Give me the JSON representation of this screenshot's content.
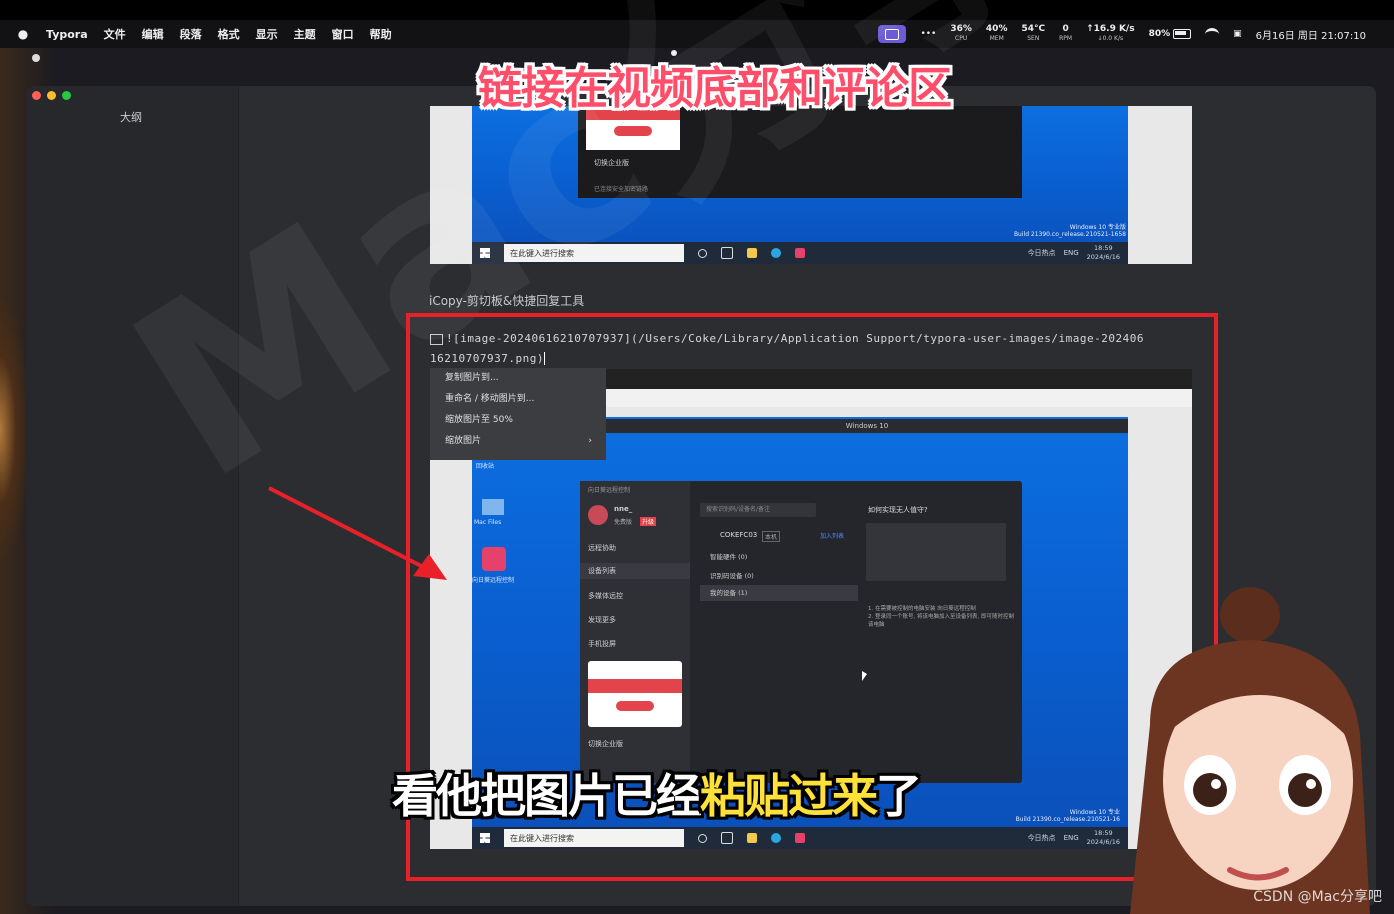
{
  "menubar": {
    "app_name": "Typora",
    "items": [
      "文件",
      "编辑",
      "段落",
      "格式",
      "显示",
      "主题",
      "窗口",
      "帮助"
    ],
    "stats": [
      {
        "value": "36%",
        "label": "CPU"
      },
      {
        "value": "40%",
        "label": "MEM"
      },
      {
        "value": "54°C",
        "label": "SEN"
      },
      {
        "value": "0",
        "label": "RPM"
      },
      {
        "value": "↑16.9 K/s",
        "label": "↓0.0 K/s"
      }
    ],
    "more": "•••",
    "battery": "80%",
    "datetime": "6月16日 周日 21:07:10"
  },
  "overlay": {
    "title": "链接在视频底部和评论区",
    "subtitle_plain": "看他把图片已经",
    "subtitle_highlight": "粘贴过来",
    "subtitle_end": "了",
    "csdn": "CSDN @Mac分享吧",
    "watermark": "Mac分享吧"
  },
  "sidebar": {
    "outline_title": "大纲"
  },
  "document": {
    "caption": "iCopy-剪切板&快捷回复工具",
    "md_line1": "![image-20240616210707937](/Users/Coke/Library/Application Support/typora-user-images/image-202406",
    "md_line2": "16210707937.png)",
    "context_menu": [
      "复制图片到...",
      "重命名 / 移动图片到...",
      "缩放图片至 50%",
      "缩放图片"
    ]
  },
  "screenshot_top": {
    "taskbar_search": "在此键入进行搜索",
    "news": "今日热点",
    "lang": "ENG",
    "time": "18:59",
    "date": "2024/6/16",
    "build_line1": "Windows 10 专业版",
    "build_line2": "Build 21390.co_release.210521-1658",
    "promo_item": "切换企业版",
    "promo_note": "已连接安全加密链路"
  },
  "screenshot_bottom": {
    "window_title": "Windows 10",
    "taskbar_search": "在此键入进行搜索",
    "news": "今日热点",
    "lang": "ENG",
    "time": "18:59",
    "date": "2024/6/16",
    "build_line1": "Windows 10 专业",
    "build_line2": "Build 21390.co_release.210521-16",
    "desktop_icon1": "Mac Files",
    "desktop_icon2": "向日葵远程控制",
    "recycle": "回收站",
    "remote": {
      "header": "向日葵远程控制",
      "user": "nne_",
      "user_sub": "免费版",
      "user_badge": "升级",
      "nav": [
        "远程协助",
        "设备列表",
        "多媒体远控",
        "发现更多",
        "手机投屏"
      ],
      "promo_item": "切换企业版",
      "search_placeholder": "搜索识别码/设备名/备注",
      "device": "COKEFC03",
      "device_tag": "本机",
      "add_list": "加入列表",
      "groups": [
        "智能硬件 (0)",
        "识别码设备 (0)",
        "我的设备 (1)"
      ],
      "help_title": "如何实现无人值守?",
      "help_text1": "1. 在需要被控制的电脑安装 向日葵远程控制",
      "help_text2": "2. 登录同一个账号, 将该电脑加入至设备列表, 即可随时控制该电脑"
    }
  }
}
